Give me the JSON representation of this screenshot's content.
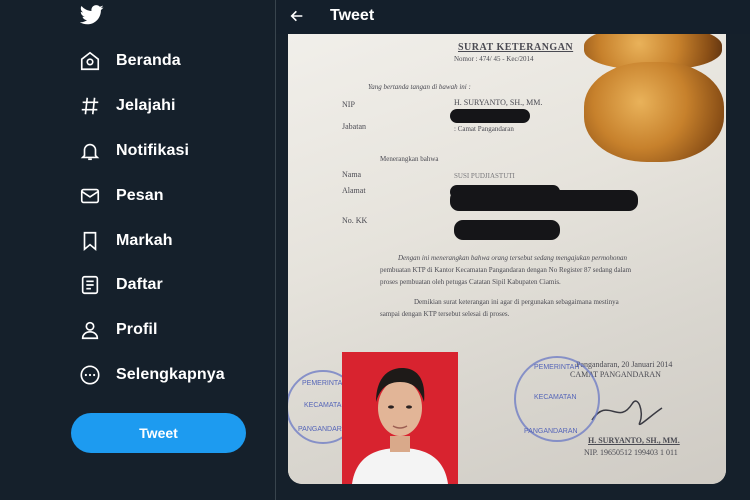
{
  "nav": {
    "items": [
      {
        "label": "Beranda",
        "icon": "home-icon"
      },
      {
        "label": "Jelajahi",
        "icon": "hashtag-icon"
      },
      {
        "label": "Notifikasi",
        "icon": "bell-icon"
      },
      {
        "label": "Pesan",
        "icon": "envelope-icon"
      },
      {
        "label": "Markah",
        "icon": "bookmark-icon"
      },
      {
        "label": "Daftar",
        "icon": "list-icon"
      },
      {
        "label": "Profil",
        "icon": "person-icon"
      },
      {
        "label": "Selengkapnya",
        "icon": "more-circle-icon"
      }
    ],
    "tweet_button": "Tweet"
  },
  "header": {
    "title": "Tweet"
  },
  "document": {
    "title": "SURAT KETERANGAN",
    "number": "Nomor : 474/ 45 - Kec/2014",
    "intro": "Yang bertanda tangan di bawah ini :",
    "nip_label": "NIP",
    "nip_value": "H. SURYANTO, SH., MM.",
    "jabatan_label": "Jabatan",
    "jabatan_value": ": Camat Pangandaran",
    "menerangkan": "Menerangkan bahwa",
    "nama_label": "Nama",
    "nama_value": "SUSI PUDJIASTUTI",
    "alamat_label": "Alamat",
    "nokk_label": "No. KK",
    "para1_l1": "Dengan ini menerangkan bahwa orang tersebut sedang mengajukan permohonan",
    "para1_l2": "pembuatan KTP di Kantor Kecamatan Pangandaran dengan No Register 87 sedang dalam",
    "para1_l3": "proses pembuatan oleh petugas Catatan Sipil Kabupaten Ciamis.",
    "para2_l1": "Demikian surat keterangan ini agar di pergunakan sebagaimana mestinya",
    "para2_l2": "sampai dengan KTP tersebut selesai di proses.",
    "place_date": "Pangandaran, 20 Januari 2014",
    "sign_title": "CAMAT PANGANDARAN",
    "signer_name": "H. SURYANTO, SH., MM.",
    "signer_nip": "NIP. 19650512 199403 1 011",
    "stamp_left_top": "PEMERINTAH",
    "stamp_left_mid": "KECAMATAN",
    "stamp_left_bottom": "PANGANDARAN",
    "stamp_right_top": "PEMERINTAH",
    "stamp_right_mid": "KECAMATAN",
    "stamp_right_bottom": "PANGANDARAN"
  },
  "colors": {
    "background": "#15202b",
    "accent": "#1d9bf0",
    "divider": "#38444d"
  }
}
